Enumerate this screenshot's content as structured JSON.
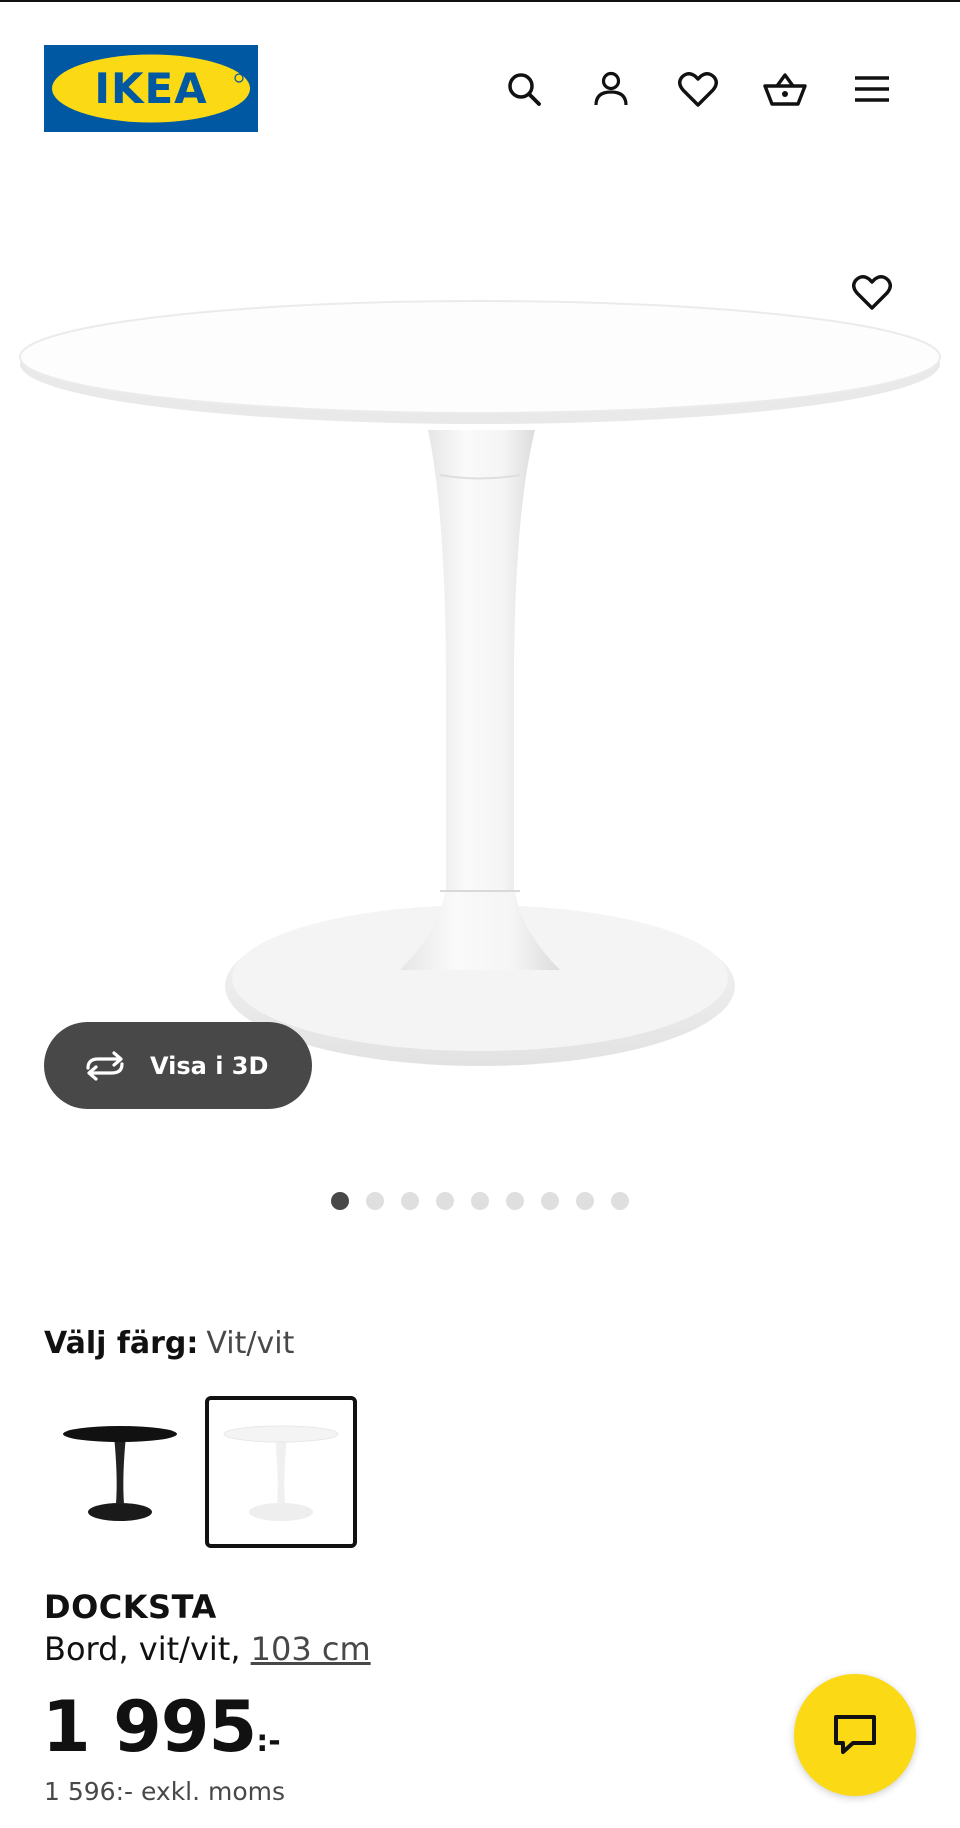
{
  "header": {
    "logo_text": "IKEA",
    "colors": {
      "brand_blue": "#0058a3",
      "brand_yellow": "#fbd914"
    },
    "icons": [
      "search-icon",
      "user-icon",
      "heart-icon",
      "basket-icon",
      "menu-icon"
    ]
  },
  "gallery": {
    "view_3d_label": "Visa i 3D",
    "image_count": 9,
    "active_index": 0
  },
  "color_picker": {
    "label": "Välj färg:",
    "selected_value": "Vit/vit",
    "options": [
      {
        "name": "Svart/svart"
      },
      {
        "name": "Vit/vit",
        "selected": true
      }
    ]
  },
  "product": {
    "name": "DOCKSTA",
    "description": "Bord, vit/vit, ",
    "size_link": "103 cm",
    "price_main": "1 995",
    "price_suffix": ":-",
    "price_excl_vat": "1 596:- exkl. moms"
  },
  "chat": {
    "icon": "chat-icon"
  }
}
